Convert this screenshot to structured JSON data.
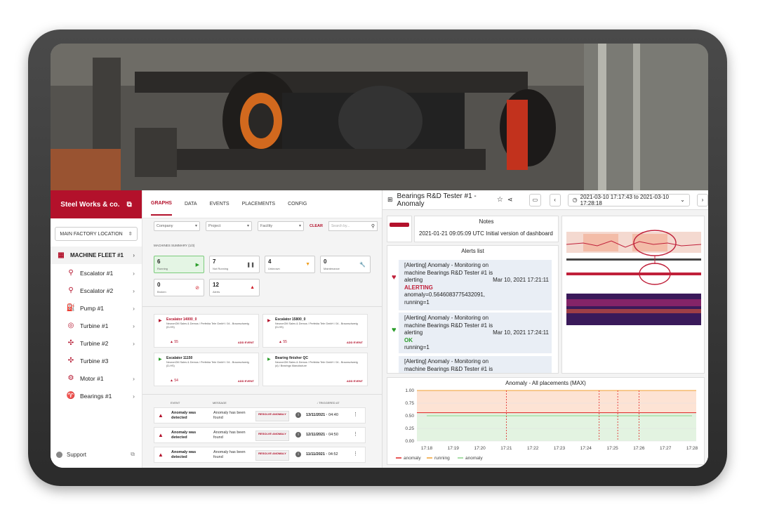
{
  "sidebar": {
    "brand": "Steel Works & co.",
    "location": "MAIN FACTORY LOCATION",
    "items": [
      {
        "label": "MACHINE FLEET #1",
        "icon": "fleet-icon",
        "active": true
      },
      {
        "label": "Escalator #1",
        "icon": "escalator-icon"
      },
      {
        "label": "Escalator #2",
        "icon": "escalator-icon"
      },
      {
        "label": "Pump #1",
        "icon": "pump-icon"
      },
      {
        "label": "Turbine #1",
        "icon": "turbine-icon"
      },
      {
        "label": "Turbine #2",
        "icon": "fan-icon"
      },
      {
        "label": "Turbine #3",
        "icon": "fan-icon"
      },
      {
        "label": "Motor #1",
        "icon": "motor-icon"
      },
      {
        "label": "Bearings #1",
        "icon": "bearing-icon"
      }
    ],
    "support": "Support"
  },
  "mid": {
    "tabs": [
      "GRAPHS",
      "DATA",
      "EVENTS",
      "PLACEMENTS",
      "CONFIG"
    ],
    "filters": {
      "company": "Company",
      "project": "Project",
      "facility": "Facility",
      "clear": "CLEAR",
      "search_placeholder": "Search by..."
    },
    "summary_label": "MACHINES SUMMARY (1/3)",
    "cards": [
      {
        "n": "6",
        "l": "Running"
      },
      {
        "n": "7",
        "l": "Not Running"
      },
      {
        "n": "4",
        "l": "Unknown"
      },
      {
        "n": "0",
        "l": "Maintenance"
      },
      {
        "n": "0",
        "l": "Broken"
      },
      {
        "n": "12",
        "l": "Alerts"
      }
    ],
    "events": [
      {
        "title": "Escalator 14000_0",
        "sub": "NeuronOM Sales & Demos / Perfekta Tele GmbH / 04 - Braunschweig (D-HS)",
        "warn": "55",
        "add": "ADD EVENT"
      },
      {
        "title": "Escalator 15800_0",
        "sub": "NeuronOM Sales & Demos / Perfekta Tele GmbH / 04 - Braunschweig (D-HS)",
        "warn": "55",
        "add": "ADD EVENT"
      },
      {
        "title": "Escalator 11150",
        "sub": "NeuronOM Sales & Demos / Perfekta Tele GmbH / 04 - Braunschweig (D-HS)",
        "warn": "54",
        "add": "ADD EVENT"
      },
      {
        "title": "Bearing finisher QC",
        "sub": "NeuronOM Sales & Demos / Perfekta Tele GmbH / 04 - Braunschweig (d) / Bearings Manufacture",
        "warn": "",
        "add": "ADD EVENT"
      }
    ],
    "event_table": {
      "h_event": "EVENT",
      "h_message": "MESSAGE",
      "h_triggered": "↓ TRIGGERED AT",
      "rows": [
        {
          "event": "Anomaly was detected",
          "message": "Anomaly has been found",
          "action": "RESOLVE ANOMALY",
          "date": "13/11/2021",
          "time": "04:40"
        },
        {
          "event": "Anomaly was detected",
          "message": "Anomaly has been found",
          "action": "RESOLVE ANOMALY",
          "date": "12/11/2021",
          "time": "04:50"
        },
        {
          "event": "Anomaly was detected",
          "message": "Anomaly has been found",
          "action": "RESOLVE ANOMALY",
          "date": "11/11/2021",
          "time": "04:52"
        }
      ]
    }
  },
  "right": {
    "title": "Bearings R&D Tester #1 - Anomaly",
    "time_range": "2021-03-10 17:17:43 to 2021-03-10 17:28:18",
    "notes_title": "Notes",
    "notes_text": "2021-01-21 09:05:09 UTC Initial version of dashboard",
    "alerts_title": "Alerts list",
    "alerts": [
      {
        "text": "[Alerting] Anomaly - Monitoring on machine Bearings R&D Tester #1 is alerting",
        "status": "ALERTING",
        "extra": "anomaly=0.5646083775432091, running=1",
        "date": "Mar 10, 2021 17:21:11"
      },
      {
        "text": "[Alerting] Anomaly - Monitoring on machine Bearings R&D Tester #1 is alerting",
        "status": "OK",
        "extra": "running=1",
        "date": "Mar 10, 2021 17:24:11"
      },
      {
        "text": "[Alerting] Anomaly - Monitoring on machine Bearings R&D Tester #1 is",
        "status": "",
        "extra": "",
        "date": ""
      }
    ],
    "chart_title": "Anomaly - All placements (MAX)",
    "legend": [
      "anomaly",
      "running",
      "anomaly"
    ],
    "colors": {
      "accent": "#b3112b",
      "anomaly": "#e02020",
      "running": "#f0a030",
      "anomaly2": "#8bd48b"
    }
  },
  "chart_data": {
    "type": "line",
    "title": "Anomaly - All placements (MAX)",
    "x": [
      "17:18",
      "17:19",
      "17:20",
      "17:21",
      "17:22",
      "17:23",
      "17:24",
      "17:25",
      "17:26",
      "17:27",
      "17:28"
    ],
    "yticks": [
      0,
      0.25,
      0.5,
      0.75,
      1.0
    ],
    "ylim": [
      0,
      1.0
    ],
    "threshold": 0.56,
    "series": [
      {
        "name": "anomaly",
        "values": [
          0.5,
          0.5,
          0.5,
          0.5,
          0.5,
          0.5,
          0.5,
          0.5,
          0.5,
          0.5,
          0.5
        ]
      },
      {
        "name": "running",
        "values": [
          1,
          1,
          1,
          1,
          1,
          1,
          1,
          1,
          1,
          1,
          1
        ]
      }
    ]
  }
}
